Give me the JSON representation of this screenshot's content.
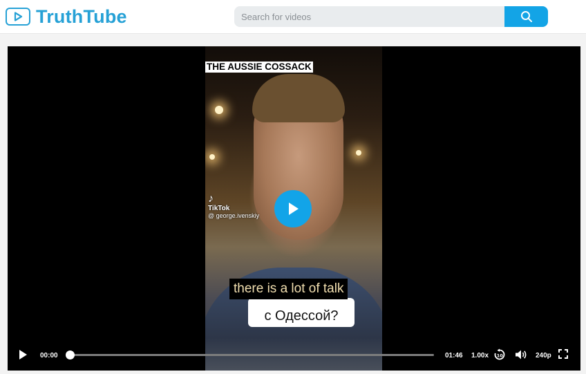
{
  "app": {
    "logo_text": "TruthTube"
  },
  "search": {
    "placeholder": "Search for videos",
    "value": ""
  },
  "video": {
    "overlay_label": "THE AUSSIE COSSACK",
    "watermark_brand": "TikTok",
    "watermark_user": "@ george.ivenskiy",
    "subtitle": "there is a lot of talk",
    "russian_caption": "с Одессой?"
  },
  "controls": {
    "current_time": "00:00",
    "duration": "01:46",
    "playback_speed": "1.00x",
    "quality": "240p",
    "progress_fraction": 0,
    "icons": [
      "play-icon",
      "rewind-10-icon",
      "volume-icon",
      "fullscreen-icon"
    ]
  },
  "colors": {
    "brand": "#26a1d6",
    "search_button": "#13a4e6",
    "play_button": "#12a4e8",
    "subtitle_text": "#f2dfb0"
  }
}
